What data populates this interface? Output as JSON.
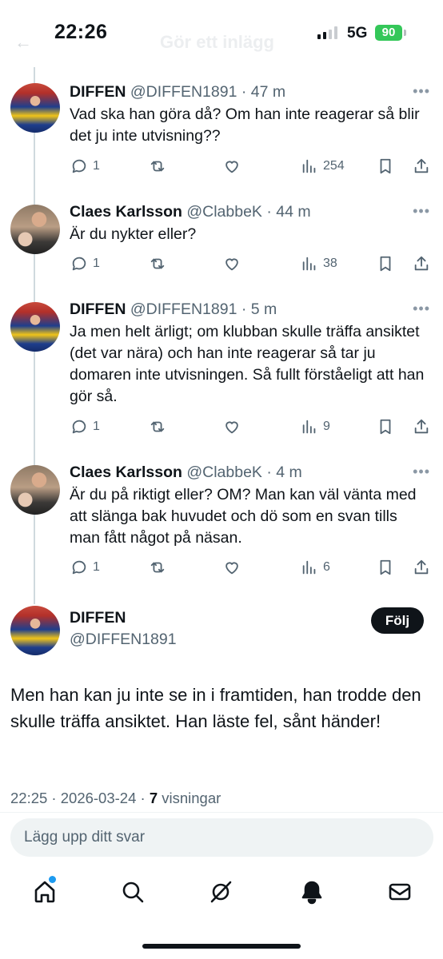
{
  "status_bar": {
    "time": "22:26",
    "network": "5G",
    "battery": "90",
    "ghost_title": "Gör ett inlägg",
    "ghost_back": "←"
  },
  "tweets": [
    {
      "avatar": "hockey-player-avatar",
      "name": "DIFFEN",
      "handle_time": "@DIFFEN1891 · 47 m",
      "text": "Vad ska han göra då? Om han inte reagerar så blir det ju inte utvisning??",
      "replies": "1",
      "retweets": "",
      "likes": "",
      "views": "254"
    },
    {
      "avatar": "man-with-child-avatar",
      "name": "Claes Karlsson",
      "handle_time": "@ClabbeK · 44 m",
      "text": "Är du nykter eller?",
      "replies": "1",
      "retweets": "",
      "likes": "",
      "views": "38"
    },
    {
      "avatar": "hockey-player-avatar",
      "name": "DIFFEN",
      "handle_time": "@DIFFEN1891 · 5 m",
      "text": "Ja men helt ärligt; om klubban skulle träffa ansiktet (det var nära) och han inte reagerar så tar ju domaren inte utvisningen. Så fullt förståeligt att han gör så.",
      "replies": "1",
      "retweets": "",
      "likes": "",
      "views": "9"
    },
    {
      "avatar": "man-with-child-avatar",
      "name": "Claes Karlsson",
      "handle_time": "@ClabbeK · 4 m",
      "text": "Är du på riktigt eller? OM? Man kan väl vänta med att slänga bak huvudet och dö som en svan tills man fått något på näsan.",
      "replies": "1",
      "retweets": "",
      "likes": "",
      "views": "6"
    }
  ],
  "main_tweet": {
    "name": "DIFFEN",
    "handle": "@DIFFEN1891",
    "follow_label": "Följ",
    "text": "Men han kan ju inte se in i framtiden, han trodde den skulle träffa ansiktet. Han läste fel, sånt händer!",
    "timestamp": "22:25 · 2026-03-24 · ",
    "views_count": "7",
    "views_label": " visningar"
  },
  "reply": {
    "placeholder": "Lägg upp ditt svar"
  },
  "nav": {
    "items": [
      "home-icon",
      "search-icon",
      "grok-icon",
      "notifications-icon",
      "messages-icon"
    ]
  },
  "colors": {
    "text": "#0f1419",
    "secondary": "#536471",
    "accent": "#1d9bf0",
    "battery": "#34c759"
  }
}
